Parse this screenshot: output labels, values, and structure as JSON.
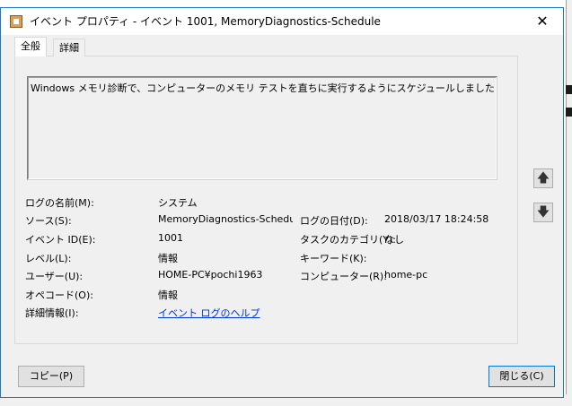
{
  "window": {
    "title": "イベント プロパティ - イベント 1001, MemoryDiagnostics-Schedule",
    "close_glyph": "✕"
  },
  "tabs": [
    {
      "label": "全般",
      "active": true
    },
    {
      "label": "詳細",
      "active": false
    }
  ],
  "description": "Windows メモリ診断で、コンピューターのメモリ テストを直ちに実行するようにスケジュールしました",
  "fields": {
    "log_name": {
      "label": "ログの名前(M):",
      "value": "システム"
    },
    "source": {
      "label": "ソース(S):",
      "value": "MemoryDiagnostics-Schedule"
    },
    "logged": {
      "label": "ログの日付(D):",
      "value": "2018/03/17 18:24:58"
    },
    "event_id": {
      "label": "イベント ID(E):",
      "value": "1001"
    },
    "task_category": {
      "label": "タスクのカテゴリ(Y):",
      "value": "なし"
    },
    "level": {
      "label": "レベル(L):",
      "value": "情報"
    },
    "keywords": {
      "label": "キーワード(K):",
      "value": ""
    },
    "user": {
      "label": "ユーザー(U):",
      "value": "HOME-PC¥pochi1963"
    },
    "computer": {
      "label": "コンピューター(R):",
      "value": "home-pc"
    },
    "opcode": {
      "label": "オペコード(O):",
      "value": "情報"
    },
    "more_info": {
      "label": "詳細情報(I):",
      "value": "イベント ログのヘルプ"
    }
  },
  "nav": {
    "up_glyph": "🡅",
    "down_glyph": "🡇"
  },
  "buttons": {
    "copy": "コピー(P)",
    "close": "閉じる(C)"
  },
  "colors": {
    "window_border": "#1979ca",
    "link": "#0033cc",
    "face": "#f0f0f0"
  }
}
